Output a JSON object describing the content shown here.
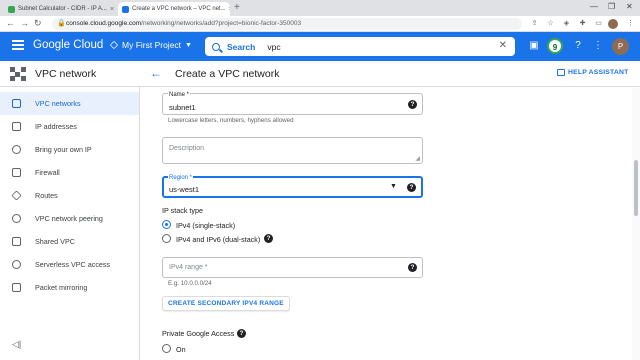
{
  "browser": {
    "tabs": [
      {
        "title": "Subnet Calculator - CIDR - IP A..."
      },
      {
        "title": "Create a VPC network – VPC net..."
      }
    ],
    "url_host": "console.cloud.google.com",
    "url_path": "/networking/networks/add?project=bionic-factor-350003"
  },
  "header": {
    "brand": "Google Cloud",
    "project": "My First Project",
    "search_label": "Search",
    "search_value": "vpc",
    "notifications_count": "9",
    "avatar_initial": "P"
  },
  "subheader": {
    "product": "VPC network",
    "page_title": "Create a VPC network",
    "help_label": "HELP ASSISTANT"
  },
  "sidebar": {
    "items": [
      {
        "label": "VPC networks",
        "active": true
      },
      {
        "label": "IP addresses"
      },
      {
        "label": "Bring your own IP"
      },
      {
        "label": "Firewall"
      },
      {
        "label": "Routes"
      },
      {
        "label": "VPC network peering"
      },
      {
        "label": "Shared VPC"
      },
      {
        "label": "Serverless VPC access"
      },
      {
        "label": "Packet mirroring"
      }
    ],
    "collapse": "◁|"
  },
  "form": {
    "name_label": "Name *",
    "name_value": "subnet1",
    "name_hint": "Lowercase letters, numbers, hyphens allowed",
    "description_placeholder": "Description",
    "region_label": "Region *",
    "region_value": "us-west1",
    "ip_stack_title": "IP stack type",
    "ip_stack_options": [
      "IPv4 (single-stack)",
      "IPv4 and IPv6 (dual-stack)"
    ],
    "ipv4_range_placeholder": "IPv4 range *",
    "ipv4_range_hint": "E.g. 10.0.0.0/24",
    "secondary_range_button": "CREATE SECONDARY IPV4 RANGE",
    "private_access_title": "Private Google Access",
    "private_access_option": "On"
  },
  "colors": {
    "brand_blue": "#1a73e8",
    "active_nav_bg": "#e8f0fe"
  }
}
